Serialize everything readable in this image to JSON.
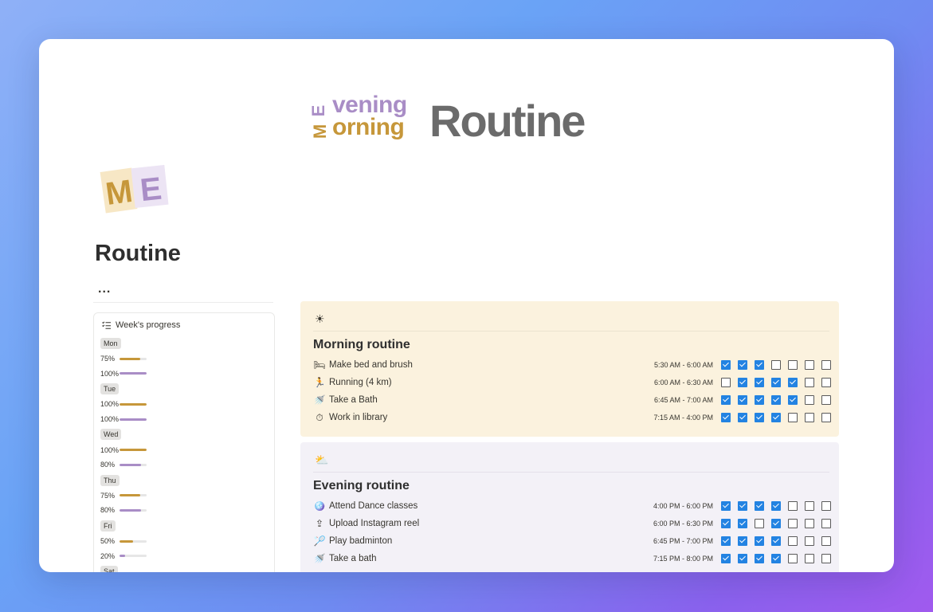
{
  "banner": {
    "evening": "vening",
    "morning": "orning",
    "routine": "Routine",
    "logo_letters": "ME"
  },
  "page": {
    "icon_letters": "ME",
    "title": "Routine",
    "more": "..."
  },
  "progress": {
    "title": "Week's progress",
    "colors": {
      "morning": "#c6973a",
      "evening": "#a98dc6"
    },
    "days": [
      {
        "label": "Mon",
        "rows": [
          {
            "pct": "75%",
            "value": 0.75,
            "kind": "morning"
          },
          {
            "pct": "100%",
            "value": 1.0,
            "kind": "evening"
          }
        ]
      },
      {
        "label": "Tue",
        "rows": [
          {
            "pct": "100%",
            "value": 1.0,
            "kind": "morning"
          },
          {
            "pct": "100%",
            "value": 1.0,
            "kind": "evening"
          }
        ]
      },
      {
        "label": "Wed",
        "rows": [
          {
            "pct": "100%",
            "value": 1.0,
            "kind": "morning"
          },
          {
            "pct": "80%",
            "value": 0.8,
            "kind": "evening"
          }
        ]
      },
      {
        "label": "Thu",
        "rows": [
          {
            "pct": "75%",
            "value": 0.75,
            "kind": "morning"
          },
          {
            "pct": "80%",
            "value": 0.8,
            "kind": "evening"
          }
        ]
      },
      {
        "label": "Fri",
        "rows": [
          {
            "pct": "50%",
            "value": 0.5,
            "kind": "morning"
          },
          {
            "pct": "20%",
            "value": 0.2,
            "kind": "evening"
          }
        ]
      },
      {
        "label": "Sat",
        "rows": []
      }
    ]
  },
  "morning": {
    "emoji": "☀",
    "title": "Morning routine",
    "tasks": [
      {
        "name": "Make bed and brush",
        "time": "5:30 AM - 6:00 AM",
        "icon": "bed-icon",
        "glyph": "🛏",
        "checks": [
          true,
          true,
          true,
          false,
          false,
          false,
          false
        ]
      },
      {
        "name": "Running (4 km)",
        "time": "6:00 AM - 6:30 AM",
        "icon": "running-icon",
        "glyph": "🏃",
        "checks": [
          false,
          true,
          true,
          true,
          true,
          false,
          false
        ]
      },
      {
        "name": "Take a Bath",
        "time": "6:45 AM - 7:00 AM",
        "icon": "shower-icon",
        "glyph": "🚿",
        "checks": [
          true,
          true,
          true,
          true,
          true,
          false,
          false
        ]
      },
      {
        "name": "Work in library",
        "time": "7:15 AM - 4:00 PM",
        "icon": "timer-icon",
        "glyph": "⏱",
        "checks": [
          true,
          true,
          true,
          true,
          false,
          false,
          false
        ]
      }
    ]
  },
  "evening": {
    "emoji": "⛅",
    "title": "Evening routine",
    "tasks": [
      {
        "name": "Attend Dance classes",
        "time": "4:00 PM - 6:00 PM",
        "icon": "disco-ball-icon",
        "glyph": "🪩",
        "checks": [
          true,
          true,
          true,
          true,
          false,
          false,
          false
        ]
      },
      {
        "name": "Upload Instagram reel",
        "time": "6:00 PM - 6:30 PM",
        "icon": "upload-icon",
        "glyph": "⇪",
        "checks": [
          true,
          true,
          false,
          true,
          false,
          false,
          false
        ]
      },
      {
        "name": "Play badminton",
        "time": "6:45 PM - 7:00 PM",
        "icon": "badminton-icon",
        "glyph": "🏸",
        "checks": [
          true,
          true,
          true,
          true,
          false,
          false,
          false
        ]
      },
      {
        "name": "Take a bath",
        "time": "7:15 PM - 8:00 PM",
        "icon": "shower-icon",
        "glyph": "🚿",
        "checks": [
          true,
          true,
          true,
          true,
          false,
          false,
          false
        ]
      }
    ]
  }
}
